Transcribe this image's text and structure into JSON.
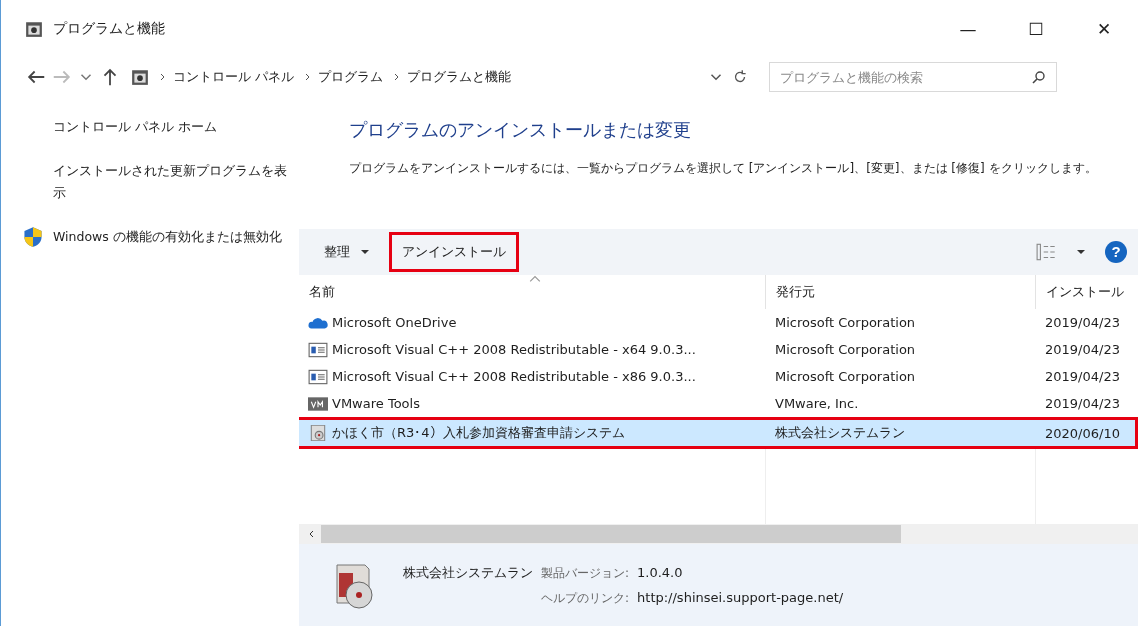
{
  "window": {
    "title": "プログラムと機能",
    "controls": [
      "—",
      "☐",
      "✕"
    ]
  },
  "address_bar": {
    "breadcrumbs": [
      "コントロール パネル",
      "プログラム",
      "プログラムと機能"
    ],
    "search": {
      "placeholder": "プログラムと機能の検索"
    }
  },
  "sidebar": {
    "items": [
      {
        "label": "コントロール パネル ホーム",
        "shield": false
      },
      {
        "label": "インストールされた更新プログラムを表示",
        "shield": false
      },
      {
        "label": "Windows の機能の有効化または無効化",
        "shield": true
      }
    ]
  },
  "heading": "プログラムのアンインストールまたは変更",
  "description": "プログラムをアンインストールするには、一覧からプログラムを選択して [アンインストール]、[変更]、または [修復] をクリックします。",
  "toolbar": {
    "help": "?",
    "buttons": [
      {
        "label": "整理",
        "dropdown": true,
        "highlighted": false
      },
      {
        "label": "アンインストール",
        "dropdown": false,
        "highlighted": true
      }
    ]
  },
  "table": {
    "columns": [
      "名前",
      "発行元",
      "インストール"
    ],
    "rows": [
      {
        "kind": "cloud",
        "name": "Microsoft OneDrive",
        "publisher": "Microsoft Corporation",
        "date": "2019/04/23",
        "selected": false,
        "highlighted": false
      },
      {
        "kind": "installer",
        "name": "Microsoft Visual C++ 2008 Redistributable - x64 9.0.3...",
        "publisher": "Microsoft Corporation",
        "date": "2019/04/23",
        "selected": false,
        "highlighted": false
      },
      {
        "kind": "installer",
        "name": "Microsoft Visual C++ 2008 Redistributable - x86 9.0.3...",
        "publisher": "Microsoft Corporation",
        "date": "2019/04/23",
        "selected": false,
        "highlighted": false
      },
      {
        "kind": "vm",
        "name": "VMware Tools",
        "publisher": "VMware, Inc.",
        "date": "2019/04/23",
        "selected": false,
        "highlighted": false
      },
      {
        "kind": "app",
        "name": "かほく市（R3･4）入札参加資格審査申請システム",
        "publisher": "株式会社システムラン",
        "date": "2020/06/10",
        "selected": true,
        "highlighted": true
      }
    ]
  },
  "details": {
    "publisher": "株式会社システムラン",
    "fields": [
      {
        "label": "製品バージョン:",
        "value": "1.0.4.0"
      },
      {
        "label": "ヘルプのリンク:",
        "value": "http://shinsei.support-page.net/"
      }
    ]
  }
}
